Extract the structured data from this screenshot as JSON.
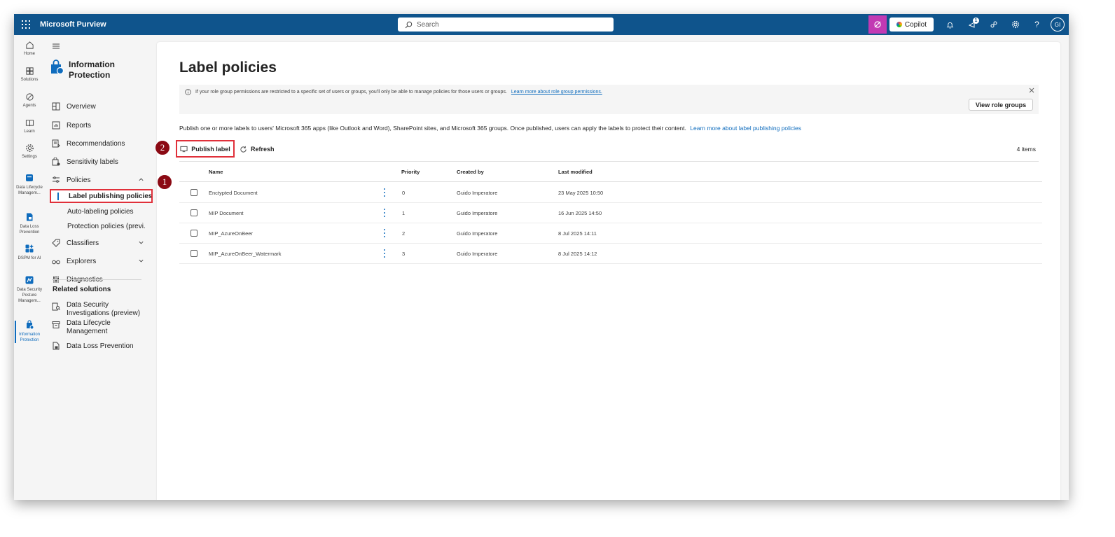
{
  "topbar": {
    "app_title": "Microsoft Purview",
    "search_placeholder": "Search",
    "copilot_label": "Copilot",
    "notifications_badge": "1",
    "avatar_initials": "GI"
  },
  "rail": {
    "items": [
      {
        "label": "Home",
        "icon": "home-icon"
      },
      {
        "label": "Solutions",
        "icon": "solutions-icon"
      },
      {
        "label": "Agents",
        "icon": "agents-icon"
      },
      {
        "label": "Learn",
        "icon": "learn-icon"
      },
      {
        "label": "Settings",
        "icon": "settings-icon"
      },
      {
        "label": "Data Lifecycle Managem...",
        "icon": "data-lifecycle-icon"
      },
      {
        "label": "Data Loss Prevention",
        "icon": "dlp-icon"
      },
      {
        "label": "DSPM for AI",
        "icon": "dspm-ai-icon"
      },
      {
        "label": "Data Security Posture Managem...",
        "icon": "dspm-icon"
      },
      {
        "label": "Information Protection",
        "icon": "information-protection-icon"
      }
    ]
  },
  "nav": {
    "solution_title": "Information Protection",
    "items": {
      "overview": "Overview",
      "reports": "Reports",
      "recommendations": "Recommendations",
      "sensitivity_labels": "Sensitivity labels",
      "policies": "Policies",
      "label_publishing_policies": "Label publishing policies",
      "auto_labeling_policies": "Auto-labeling policies",
      "protection_policies": "Protection policies (previ...",
      "classifiers": "Classifiers",
      "explorers": "Explorers",
      "diagnostics": "Diagnostics"
    },
    "related_title": "Related solutions",
    "related": {
      "dsi_line1": "Data Security",
      "dsi_line2": "Investigations (preview)",
      "dlm_line1": "Data Lifecycle",
      "dlm_line2": "Management",
      "dlp": "Data Loss Prevention"
    }
  },
  "main": {
    "title": "Label policies",
    "info_text": "If your role group permissions are restricted to a specific set of users or groups, you'll only be able to manage policies for those users or groups.",
    "info_link": "Learn more about role group permissions.",
    "view_role_groups": "View role groups",
    "description": "Publish one or more labels to users' Microsoft 365 apps (like Outlook and Word), SharePoint sites, and Microsoft 365 groups. Once published, users can apply the labels to protect their content.",
    "description_link": "Learn more about label publishing policies",
    "publish_label": "Publish label",
    "refresh": "Refresh",
    "item_count": "4 items",
    "columns": {
      "name": "Name",
      "priority": "Priority",
      "created_by": "Created by",
      "last_modified": "Last modified"
    },
    "rows": [
      {
        "name": "Enctypted Document",
        "priority": "0",
        "created_by": "Guido Imperatore",
        "last_modified": "23 May 2025 10:50"
      },
      {
        "name": "MIP Document",
        "priority": "1",
        "created_by": "Guido Imperatore",
        "last_modified": "16 Jun 2025 14:50"
      },
      {
        "name": "MIP_AzureOnBeer",
        "priority": "2",
        "created_by": "Guido Imperatore",
        "last_modified": "8 Jul 2025 14:11"
      },
      {
        "name": "MIP_AzureOnBeer_Watermark",
        "priority": "3",
        "created_by": "Guido Imperatore",
        "last_modified": "8 Jul 2025 14:12"
      }
    ]
  },
  "callouts": {
    "one": "1",
    "two": "2"
  },
  "colors": {
    "topbar": "#0f548c",
    "accent": "#0f6cbd",
    "highlight": "#e0303a",
    "marker": "#8b0a14",
    "copilot_button": "#c239b3"
  }
}
